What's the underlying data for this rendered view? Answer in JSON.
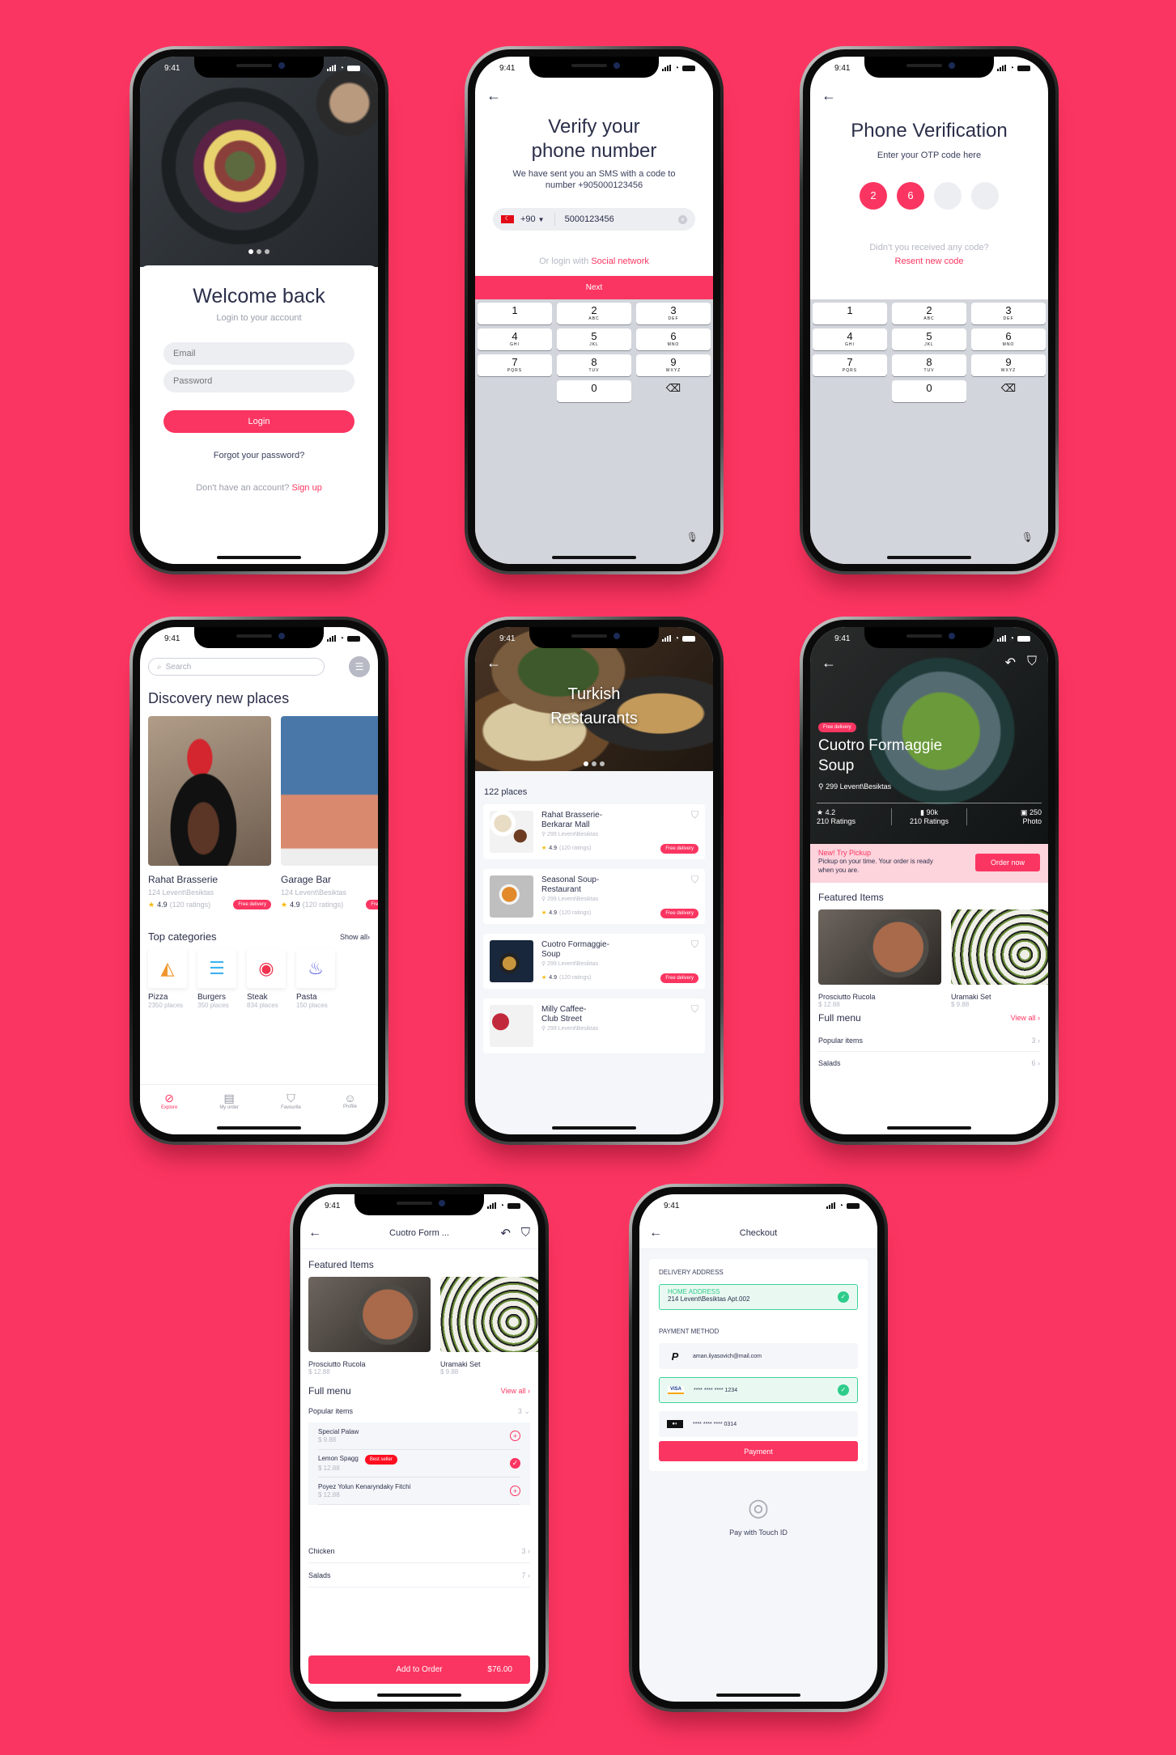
{
  "colors": {
    "background": "#fb3561",
    "accent": "#fb3561",
    "text_dark": "#2b2f4a",
    "success": "#2ecc8a",
    "best_seller": "#ff0d1f"
  },
  "status_time": "9:41",
  "login": {
    "title": "Welcome back",
    "subtitle": "Login to your account",
    "email_placeholder": "Email",
    "password_placeholder": "Password",
    "login_button": "Login",
    "forgot": "Forgot your password?",
    "no_account": "Don't have an account?",
    "signup": "Sign up",
    "carousel_pages": 3,
    "carousel_active": 1
  },
  "verify": {
    "title_line1": "Verify your",
    "title_line2": "phone number",
    "desc_line1": "We have sent you an SMS with a code to",
    "desc_line2": "number +905000123456",
    "country_code": "+90",
    "phone_value": "5000123456",
    "or_login": "Or login with",
    "social": "Social network",
    "next": "Next"
  },
  "keypad": [
    {
      "d": "1",
      "l": ""
    },
    {
      "d": "2",
      "l": "ABC"
    },
    {
      "d": "3",
      "l": "DEF"
    },
    {
      "d": "4",
      "l": "GHI"
    },
    {
      "d": "5",
      "l": "JKL"
    },
    {
      "d": "6",
      "l": "MNO"
    },
    {
      "d": "7",
      "l": "PQRS"
    },
    {
      "d": "8",
      "l": "TUV"
    },
    {
      "d": "9",
      "l": "WXYZ"
    },
    {
      "d": "0",
      "l": ""
    }
  ],
  "otp": {
    "title": "Phone Verification",
    "subtitle": "Enter your OTP code here",
    "digits": [
      "2",
      "6",
      "",
      ""
    ],
    "no_code": "Didn’t you received any code?",
    "resend": "Resent new code"
  },
  "discovery": {
    "search_placeholder": "Search",
    "title": "Discovery new places",
    "places": [
      {
        "name": "Rahat Brasserie",
        "address": "124 Levent\\Besiktas",
        "rating": "4.9",
        "ratings": "(120 ratings)",
        "badge": "Free delivery"
      },
      {
        "name": "Garage Bar",
        "address": "124 Levent\\Besiktas",
        "rating": "4.9",
        "ratings": "(120 ratings)",
        "badge": "Free delivery"
      }
    ],
    "categories_title": "Top categories",
    "show_all": "Show all",
    "categories": [
      {
        "name": "Pizza",
        "count": "2350 places",
        "icon": "pizza-icon",
        "color": "#f0962d"
      },
      {
        "name": "Burgers",
        "count": "350 places",
        "icon": "burger-icon",
        "color": "#3db3f0"
      },
      {
        "name": "Steak",
        "count": "834 places",
        "icon": "steak-icon",
        "color": "#f0324f"
      },
      {
        "name": "Pasta",
        "count": "150 places",
        "icon": "pasta-icon",
        "color": "#5b5fe0"
      }
    ],
    "tabs": [
      {
        "label": "Explore",
        "icon": "compass-icon",
        "active": true
      },
      {
        "label": "My order",
        "icon": "receipt-icon",
        "active": false
      },
      {
        "label": "Favourite",
        "icon": "bookmark-icon",
        "active": false
      },
      {
        "label": "Profile",
        "icon": "profile-icon",
        "active": false
      }
    ]
  },
  "turkish": {
    "title_line1": "Turkish",
    "title_line2": "Restaurants",
    "count": "122 places",
    "restaurants": [
      {
        "name1": "Rahat Brasserie-",
        "name2": "Berkarar Mall",
        "address": "299 Levent\\Besiktas",
        "rating": "4.9",
        "ratings": "(120 ratings)",
        "badge": "Free delivery"
      },
      {
        "name1": "Seasonal Soup-",
        "name2": "Restaurant",
        "address": "299 Levent\\Besiktas",
        "rating": "4.9",
        "ratings": "(120 ratings)",
        "badge": "Free delivery"
      },
      {
        "name1": "Cuotro Formaggie-",
        "name2": "Soup",
        "address": "299 Levent\\Besiktas",
        "rating": "4.9",
        "ratings": "(120 ratings)",
        "badge": "Free delivery"
      },
      {
        "name1": "Milly Caffee-",
        "name2": "Club Street",
        "address": "299 Levent\\Besiktas",
        "rating": "",
        "ratings": "",
        "badge": ""
      }
    ]
  },
  "detail": {
    "badge": "Free delivery",
    "title_line1": "Cuotro Formaggie",
    "title_line2": "Soup",
    "address": "299 Levent\\Besiktas",
    "stats": [
      {
        "value": "4.2",
        "label": "210 Ratings",
        "icon": "star-icon"
      },
      {
        "value": "90k",
        "label": "210 Ratings",
        "icon": "bookmark-icon"
      },
      {
        "value": "250",
        "label": "Photo",
        "icon": "photo-icon"
      }
    ],
    "promo_title": "New! Try Pickup",
    "promo_text": "Pickup on your time. Your order is ready when you are.",
    "order_now": "Order now",
    "featured_title": "Featured Items",
    "featured": [
      {
        "name": "Prosciutto Rucola",
        "price": "$ 12.88"
      },
      {
        "name": "Uramaki Set",
        "price": "$ 9.88"
      }
    ],
    "menu_title": "Full menu",
    "view_all": "View all",
    "menu": [
      {
        "name": "Popular items",
        "count": "3"
      },
      {
        "name": "Salads",
        "count": "6"
      }
    ]
  },
  "menu_page": {
    "title": "Cuotro Form ...",
    "featured_title": "Featured Items",
    "featured": [
      {
        "name": "Prosciutto Rucola",
        "price": "$ 12.88"
      },
      {
        "name": "Uramaki Set",
        "price": "$ 9.88"
      }
    ],
    "menu_title": "Full menu",
    "view_all": "View all",
    "popular": {
      "name": "Popular items",
      "count": "3"
    },
    "items": [
      {
        "name": "Special Palaw",
        "price": "$ 9.88",
        "badge": "",
        "selected": false
      },
      {
        "name": "Lemon Spagg",
        "price": "$ 12.88",
        "badge": "Best seller",
        "selected": true
      },
      {
        "name": "Poyez Yolun Kenaryndaky Fitchi",
        "price": "$ 12.88",
        "badge": "",
        "selected": false
      }
    ],
    "categories": [
      {
        "name": "Chicken",
        "count": "3"
      },
      {
        "name": "Salads",
        "count": "7"
      }
    ],
    "add_to_order": "Add to Order",
    "total": "$76.00"
  },
  "checkout": {
    "title": "Checkout",
    "delivery_label": "DELIVERY ADDRESS",
    "address_title": "HOME ADDRESS",
    "address": "214 Levent\\Besiktas Apt.002",
    "payment_label": "PAYMENT METHOD",
    "methods": [
      {
        "type": "paypal",
        "text": "aman.ilyasovich@mail.com",
        "selected": false
      },
      {
        "type": "visa",
        "text": "**** **** **** 1234",
        "selected": true
      },
      {
        "type": "card",
        "text": "**** **** **** 0314",
        "selected": false
      }
    ],
    "payment_button": "Payment",
    "touch_id": "Pay with Touch ID"
  }
}
